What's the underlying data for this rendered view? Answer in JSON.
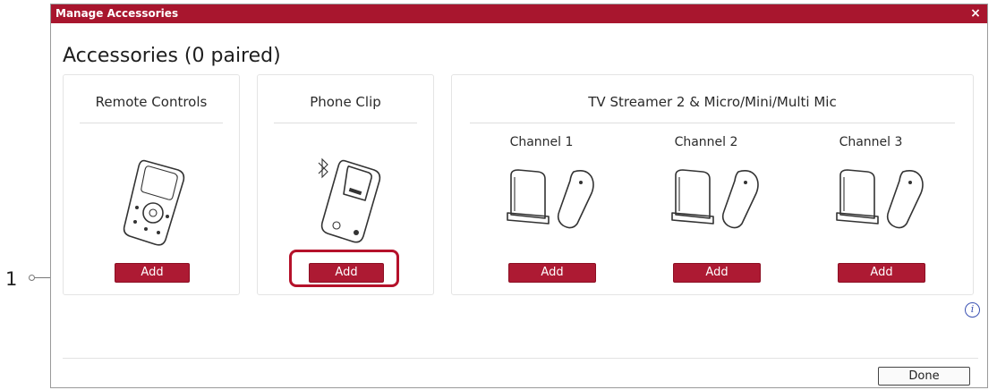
{
  "window": {
    "title": "Manage Accessories",
    "close_symbol": "×"
  },
  "heading": "Accessories (0 paired)",
  "panels": {
    "remote": {
      "title": "Remote Controls",
      "add_label": "Add",
      "device_icon": "remote-control-icon"
    },
    "phone_clip": {
      "title": "Phone Clip",
      "add_label": "Add",
      "device_icon": "phone-clip-icon"
    },
    "streamer": {
      "title": "TV Streamer 2 & Micro/Mini/Multi Mic",
      "channels": [
        {
          "label": "Channel 1",
          "add_label": "Add"
        },
        {
          "label": "Channel 2",
          "add_label": "Add"
        },
        {
          "label": "Channel 3",
          "add_label": "Add"
        }
      ]
    }
  },
  "info_symbol": "i",
  "done_label": "Done",
  "callout": {
    "number": "1"
  },
  "colors": {
    "titlebar": "#a8162e",
    "button": "#ad1a33",
    "highlight": "#b5112a",
    "info": "#3b52b3"
  }
}
